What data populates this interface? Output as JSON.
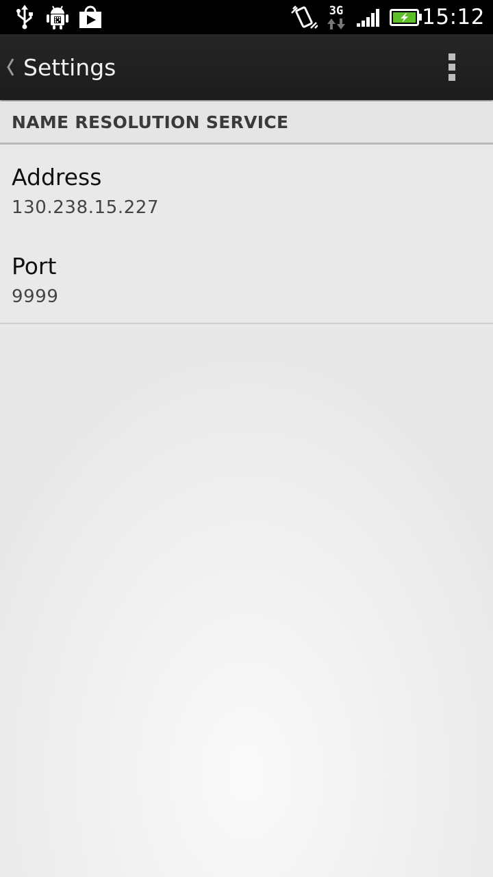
{
  "status_bar": {
    "time": "15:12",
    "network_type": "3G",
    "left_icons": [
      "usb-icon",
      "android-debug-icon",
      "play-store-icon"
    ],
    "right_icons": [
      "vibrate-icon",
      "3g-data-icon",
      "signal-icon",
      "battery-charging-icon"
    ],
    "battery_color": "#5fbf2a"
  },
  "action_bar": {
    "title": "Settings",
    "back_icon": "chevron-left-icon",
    "menu_icon": "overflow-menu-icon"
  },
  "section": {
    "header": "NAME RESOLUTION SERVICE"
  },
  "preferences": [
    {
      "title": "Address",
      "summary": "130.238.15.227"
    },
    {
      "title": "Port",
      "summary": "9999"
    }
  ]
}
